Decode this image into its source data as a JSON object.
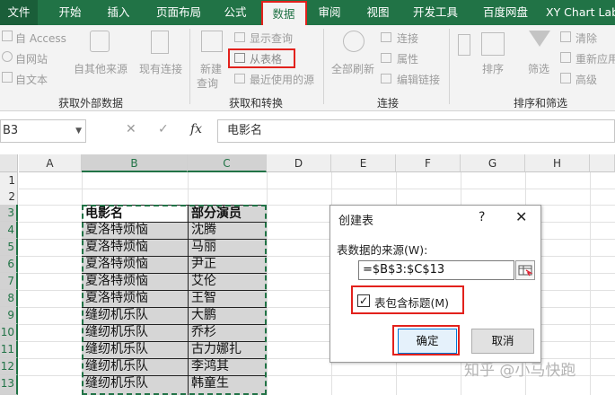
{
  "ribbon_tabs": [
    {
      "label": "文件"
    },
    {
      "label": "开始"
    },
    {
      "label": "插入"
    },
    {
      "label": "页面布局"
    },
    {
      "label": "公式"
    },
    {
      "label": "数据"
    },
    {
      "label": "审阅"
    },
    {
      "label": "视图"
    },
    {
      "label": "开发工具"
    },
    {
      "label": "百度网盘"
    },
    {
      "label": "XY Chart Lab"
    }
  ],
  "active_tab": "数据",
  "ribbon": {
    "get_external": {
      "access": "自 Access",
      "web": "自网站",
      "text": "自文本",
      "other_sources": "自其他来源",
      "existing": "现有连接",
      "group_label": "获取外部数据"
    },
    "get_transform": {
      "new_query_1": "新建",
      "new_query_2": "查询",
      "show_queries": "显示查询",
      "from_table": "从表格",
      "recent_sources": "最近使用的源",
      "group_label": "获取和转换"
    },
    "connections": {
      "refresh_all": "全部刷新",
      "connections": "连接",
      "properties": "属性",
      "edit_links": "编辑链接",
      "group_label": "连接"
    },
    "sort_filter": {
      "sort": "排序",
      "filter": "筛选",
      "clear": "清除",
      "reapply": "重新应用",
      "advanced": "高级",
      "group_label": "排序和筛选"
    }
  },
  "formula_bar": {
    "name_box": "B3",
    "cancel_icon": "✕",
    "enter_icon": "✓",
    "fx_label": "fx",
    "content": "电影名"
  },
  "columns": [
    "A",
    "B",
    "C",
    "D",
    "E",
    "F",
    "G",
    "H"
  ],
  "rows": [
    "1",
    "2",
    "3",
    "4",
    "5",
    "6",
    "7",
    "8",
    "9",
    "10",
    "11",
    "12",
    "13"
  ],
  "table": {
    "headers": [
      "电影名",
      "部分演员"
    ],
    "rows": [
      [
        "夏洛特烦恼",
        "沈腾"
      ],
      [
        "夏洛特烦恼",
        "马丽"
      ],
      [
        "夏洛特烦恼",
        "尹正"
      ],
      [
        "夏洛特烦恼",
        "艾伦"
      ],
      [
        "夏洛特烦恼",
        "王智"
      ],
      [
        "缝纫机乐队",
        "大鹏"
      ],
      [
        "缝纫机乐队",
        "乔杉"
      ],
      [
        "缝纫机乐队",
        "古力娜扎"
      ],
      [
        "缝纫机乐队",
        "李鸿其"
      ],
      [
        "缝纫机乐队",
        "韩童生"
      ]
    ]
  },
  "dialog": {
    "title": "创建表",
    "help": "?",
    "close": "✕",
    "source_label": "表数据的来源(W):",
    "range_value": "=$B$3:$C$13",
    "has_headers_label": "表包含标题(M)",
    "has_headers_checked": "✓",
    "ok_label": "确定",
    "cancel_label": "取消"
  },
  "watermark": "知乎 @小马快跑",
  "colors": {
    "excel_green": "#217346",
    "highlight_red": "#e2211c"
  }
}
